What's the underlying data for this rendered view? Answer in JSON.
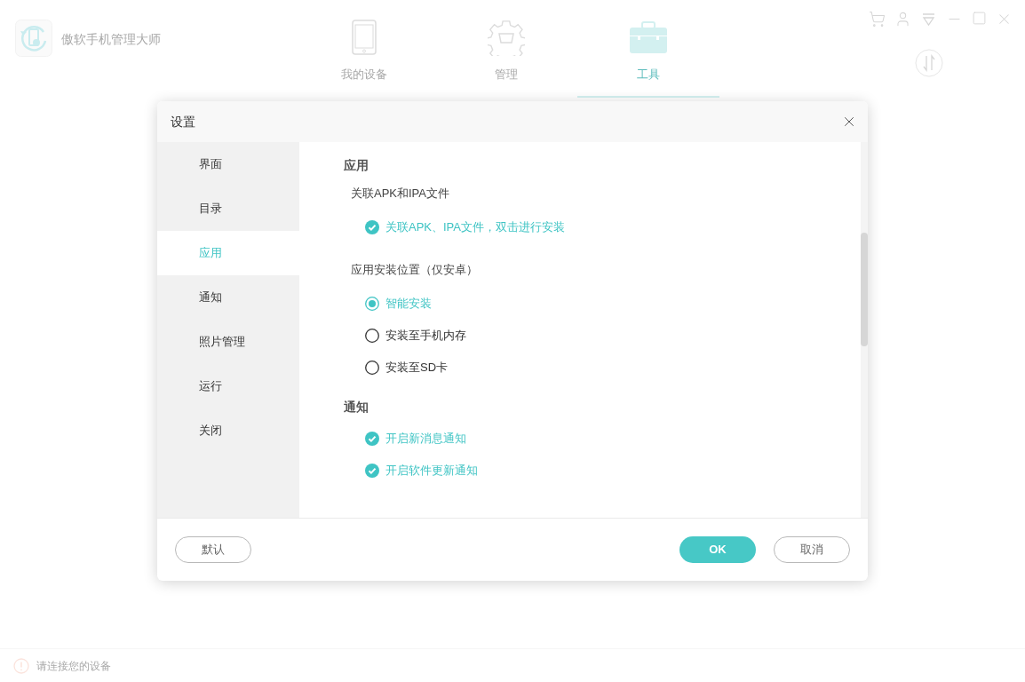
{
  "app": {
    "title": "傲软手机管理大师",
    "nav": [
      {
        "kind": "phone",
        "label": "我的设备",
        "selected": false
      },
      {
        "kind": "gear",
        "label": "管理",
        "selected": false
      },
      {
        "kind": "toolbox",
        "label": "工具",
        "selected": true
      }
    ],
    "status": "请连接您的设备"
  },
  "dialog": {
    "title": "设置",
    "sidebar": [
      {
        "label": "界面",
        "selected": false
      },
      {
        "label": "目录",
        "selected": false
      },
      {
        "label": "应用",
        "selected": true
      },
      {
        "label": "通知",
        "selected": false
      },
      {
        "label": "照片管理",
        "selected": false
      },
      {
        "label": "运行",
        "selected": false
      },
      {
        "label": "关闭",
        "selected": false
      }
    ],
    "sections": [
      {
        "title": "应用",
        "groups": [
          {
            "label": "关联APK和IPA文件",
            "options": [
              {
                "kind": "checkbox",
                "label": "关联APK、IPA文件，双击进行安装",
                "checked": true
              }
            ]
          },
          {
            "label": "应用安装位置（仅安卓）",
            "options": [
              {
                "kind": "radio",
                "label": "智能安装",
                "selected": true
              },
              {
                "kind": "radio",
                "label": "安装至手机内存",
                "selected": false
              },
              {
                "kind": "radio",
                "label": "安装至SD卡",
                "selected": false
              }
            ]
          }
        ]
      },
      {
        "title": "通知",
        "groups": [
          {
            "options": [
              {
                "kind": "checkbox",
                "label": "开启新消息通知",
                "checked": true
              },
              {
                "kind": "checkbox",
                "label": "开启软件更新通知",
                "checked": true
              }
            ]
          }
        ]
      }
    ],
    "buttons": [
      {
        "kind": "outline",
        "label": "默认"
      },
      {
        "kind": "primary",
        "label": "OK"
      },
      {
        "kind": "outline",
        "label": "取消"
      }
    ]
  }
}
